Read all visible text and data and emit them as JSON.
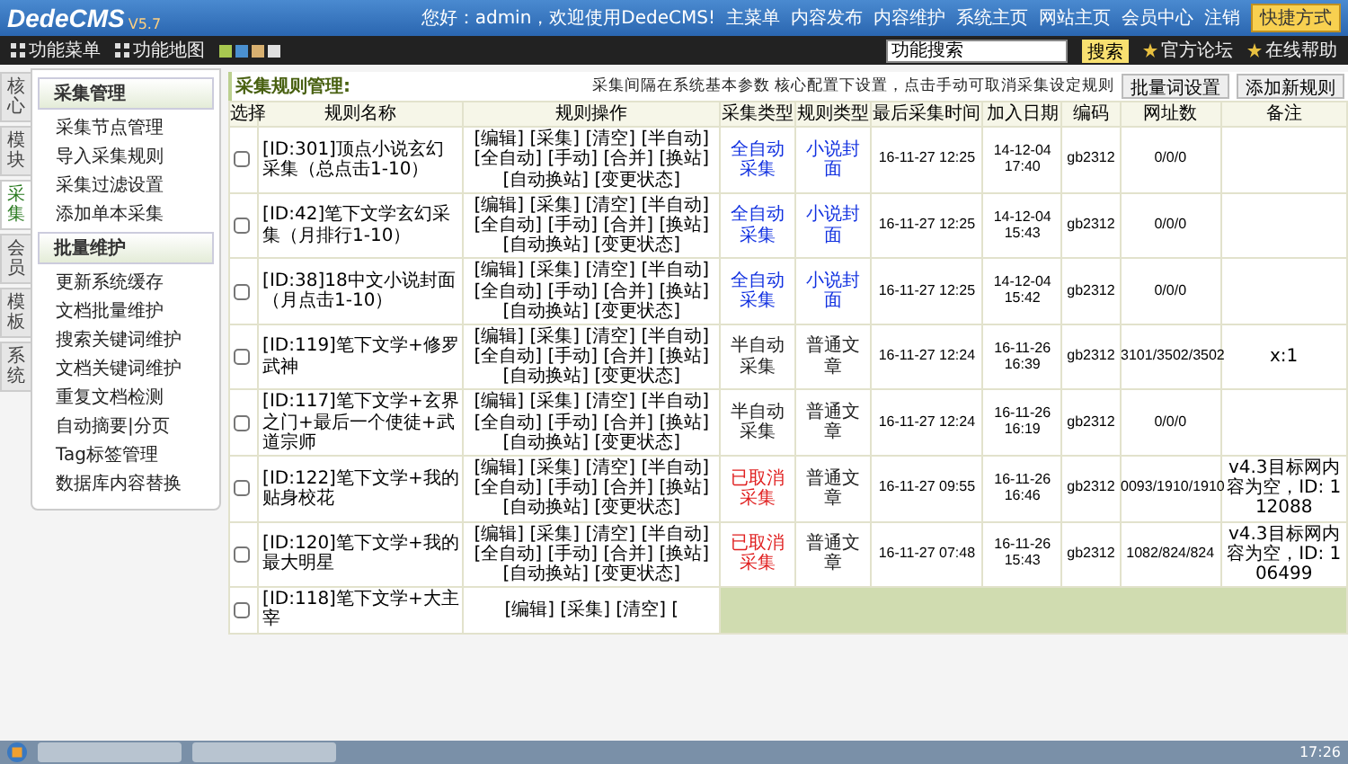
{
  "header": {
    "logo": "DedeCMS",
    "version": "V5.7",
    "greeting": "您好：admin，欢迎使用DedeCMS!",
    "nav": [
      "主菜单",
      "内容发布",
      "内容维护",
      "系统主页",
      "网站主页",
      "会员中心",
      "注销"
    ],
    "shortcut": "快捷方式"
  },
  "toolbar": {
    "items": [
      "功能菜单",
      "功能地图"
    ],
    "swatches": [
      {
        "color": "#a8c850"
      },
      {
        "color": "#4a90d0"
      },
      {
        "color": "#d8b070"
      },
      {
        "color": "#e0e0e0"
      }
    ],
    "search": {
      "placeholder": "功能搜索"
    },
    "search_button": "搜索",
    "links": [
      "官方论坛",
      "在线帮助"
    ]
  },
  "side_tabs": [
    {
      "label": "核心",
      "selected": false
    },
    {
      "label": "模块",
      "selected": false
    },
    {
      "label": "采集",
      "selected": true
    },
    {
      "label": "会员",
      "selected": false
    },
    {
      "label": "模板",
      "selected": false
    },
    {
      "label": "系统",
      "selected": false
    }
  ],
  "menu": [
    {
      "title": "采集管理",
      "items": [
        "采集节点管理",
        "导入采集规则",
        "采集过滤设置",
        "添加单本采集"
      ]
    },
    {
      "title": "批量维护",
      "items": [
        "更新系统缓存",
        "文档批量维护",
        "搜索关键词维护",
        "文档关键词维护",
        "重复文档检测",
        "自动摘要|分页",
        "Tag标签管理",
        "数据库内容替换"
      ]
    }
  ],
  "main": {
    "title": "采集规则管理:",
    "note": "采集间隔在系统基本参数 核心配置下设置，点击手动可取消采集设定规则",
    "buttons": [
      "批量词设置",
      "添加新规则"
    ],
    "columns": [
      "选择",
      "规则名称",
      "规则操作",
      "采集类型",
      "规则类型",
      "最后采集时间",
      "加入日期",
      "编码",
      "网址数",
      "备注"
    ],
    "rows": [
      {
        "checked": false,
        "name": "[ID:301]顶点小说玄幻采集（总点击1-10）",
        "ops": "[编辑] [采集] [清空] [半自动] [全自动] [手动] [合并] [换站] [自动换站] [变更状态]",
        "collect": {
          "kind": "auto",
          "text": "全自动采集"
        },
        "rule": {
          "kind": "cover",
          "text": "小说封面"
        },
        "last": "16-11-27 12:25",
        "added": "14-12-04 17:40",
        "encoding": "gb2312",
        "urls": "0/0/0"
      },
      {
        "checked": false,
        "name": "[ID:42]笔下文学玄幻采集（月排行1-10）",
        "ops": "[编辑] [采集] [清空] [半自动] [全自动] [手动] [合并] [换站] [自动换站] [变更状态]",
        "collect": {
          "kind": "auto",
          "text": "全自动采集"
        },
        "rule": {
          "kind": "cover",
          "text": "小说封面"
        },
        "last": "16-11-27 12:25",
        "added": "14-12-04 15:43",
        "encoding": "gb2312",
        "urls": "0/0/0"
      },
      {
        "checked": false,
        "name": "[ID:38]18中文小说封面（月点击1-10）",
        "ops": "[编辑] [采集] [清空] [半自动] [全自动] [手动] [合并] [换站] [自动换站] [变更状态]",
        "collect": {
          "kind": "auto",
          "text": "全自动采集"
        },
        "rule": {
          "kind": "cover",
          "text": "小说封面"
        },
        "last": "16-11-27 12:25",
        "added": "14-12-04 15:42",
        "encoding": "gb2312",
        "urls": "0/0/0"
      },
      {
        "checked": false,
        "name": "[ID:119]笔下文学+修罗武神",
        "ops": "[编辑] [采集] [清空] [半自动] [全自动] [手动] [合并] [换站] [自动换站] [变更状态]",
        "collect": {
          "kind": "semi",
          "text": "半自动采集"
        },
        "rule": {
          "kind": "article",
          "text": "普通文章"
        },
        "last": "16-11-27 12:24",
        "added": "16-11-26 16:39",
        "encoding": "gb2312",
        "urls": "3101/3502/3502",
        "note": "x:1"
      },
      {
        "checked": false,
        "name": "[ID:117]笔下文学+玄界之门+最后一个使徒+武道宗师",
        "ops": "[编辑] [采集] [清空] [半自动] [全自动] [手动] [合并] [换站] [自动换站] [变更状态]",
        "collect": {
          "kind": "semi",
          "text": "半自动采集"
        },
        "rule": {
          "kind": "article",
          "text": "普通文章"
        },
        "last": "16-11-27 12:24",
        "added": "16-11-26 16:19",
        "encoding": "gb2312",
        "urls": "0/0/0"
      },
      {
        "checked": false,
        "name": "[ID:122]笔下文学+我的贴身校花",
        "ops": "[编辑] [采集] [清空] [半自动] [全自动] [手动] [合并] [换站] [自动换站] [变更状态]",
        "collect": {
          "kind": "cancelled",
          "text": "已取消采集"
        },
        "rule": {
          "kind": "article",
          "text": "普通文章"
        },
        "last": "16-11-27 09:55",
        "added": "16-11-26 16:46",
        "encoding": "gb2312",
        "urls": "0093/1910/1910",
        "note": "v4.3目标网内容为空，ID: 112088"
      },
      {
        "checked": false,
        "name": "[ID:120]笔下文学+我的最大明星",
        "ops": "[编辑] [采集] [清空] [半自动] [全自动] [手动] [合并] [换站] [自动换站] [变更状态]",
        "collect": {
          "kind": "cancelled",
          "text": "已取消采集"
        },
        "rule": {
          "kind": "article",
          "text": "普通文章"
        },
        "last": "16-11-27 07:48",
        "added": "16-11-26 15:43",
        "encoding": "gb2312",
        "urls": "1082/824/824",
        "note": "v4.3目标网内容为空，ID: 106499"
      },
      {
        "checked": false,
        "name": "[ID:118]笔下文学+大主宰",
        "ops": "[编辑] [采集] [清空] ["
      }
    ]
  },
  "taskbar": {
    "clock": "17:26"
  }
}
